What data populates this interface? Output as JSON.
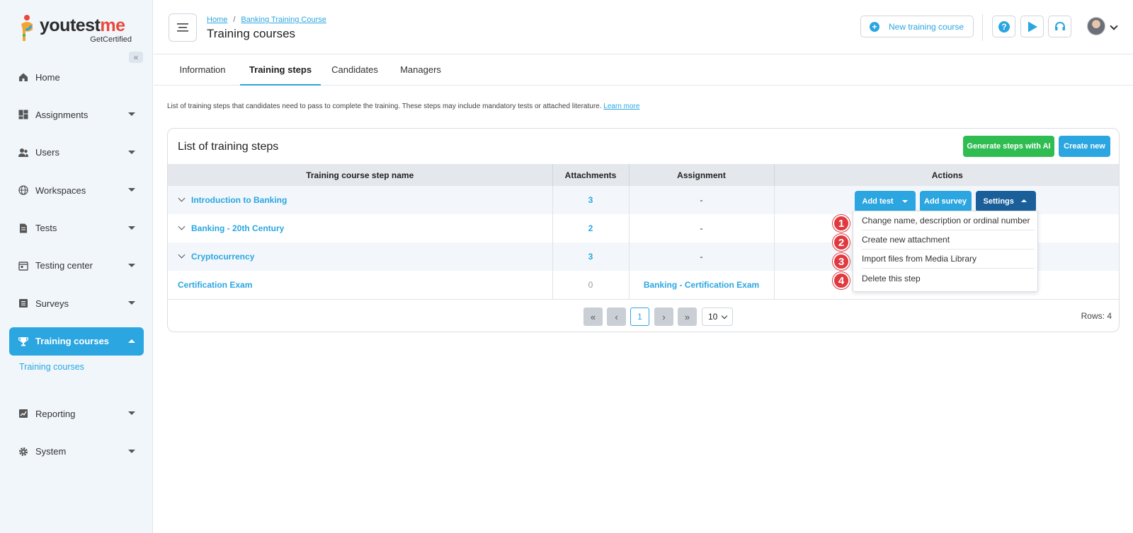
{
  "brand": {
    "name_a": "youtest",
    "name_b": "me",
    "tagline": "GetCertified"
  },
  "sidebar": {
    "items": [
      {
        "label": "Home",
        "icon": "home-icon",
        "has_caret": false
      },
      {
        "label": "Assignments",
        "icon": "dashboard-icon",
        "has_caret": true
      },
      {
        "label": "Users",
        "icon": "users-icon",
        "has_caret": true
      },
      {
        "label": "Workspaces",
        "icon": "globe-icon",
        "has_caret": true
      },
      {
        "label": "Tests",
        "icon": "file-icon",
        "has_caret": true
      },
      {
        "label": "Testing center",
        "icon": "calendar-icon",
        "has_caret": true
      },
      {
        "label": "Surveys",
        "icon": "list-icon",
        "has_caret": true
      },
      {
        "label": "Training courses",
        "icon": "trophy-icon",
        "has_caret": true,
        "active": true
      },
      {
        "label": "Reporting",
        "icon": "chart-icon",
        "has_caret": true
      },
      {
        "label": "System",
        "icon": "gear-icon",
        "has_caret": true
      }
    ],
    "subitem": "Training courses"
  },
  "header": {
    "breadcrumb": [
      "Home",
      "Banking Training Course"
    ],
    "title": "Training courses",
    "new_course_label": "New training course"
  },
  "tabs": [
    "Information",
    "Training steps",
    "Candidates",
    "Managers"
  ],
  "active_tab": "Training steps",
  "description": "List of training steps that candidates need to pass to complete the training. These steps may include mandatory tests or attached literature.",
  "learn_more": "Learn more",
  "card": {
    "title": "List of training steps",
    "generate_label": "Generate steps with AI",
    "create_label": "Create new"
  },
  "table": {
    "columns": [
      "Training course step name",
      "Attachments",
      "Assignment",
      "Actions"
    ],
    "rows": [
      {
        "name": "Introduction to Banking",
        "attachments": "3",
        "assignment": "-"
      },
      {
        "name": "Banking - 20th Century",
        "attachments": "2",
        "assignment": "-"
      },
      {
        "name": "Cryptocurrency",
        "attachments": "3",
        "assignment": "-"
      },
      {
        "name": "Certification Exam",
        "attachments": "0",
        "assignment": "Banking - Certification Exam"
      }
    ],
    "actions": {
      "add_test": "Add test",
      "add_survey": "Add survey",
      "settings": "Settings"
    }
  },
  "pager": {
    "current": "1",
    "page_size": "10",
    "rows_label": "Rows: 4"
  },
  "dropdown": {
    "items": [
      {
        "num": "1",
        "label": "Change name, description or ordinal number"
      },
      {
        "num": "2",
        "label": "Create new attachment"
      },
      {
        "num": "3",
        "label": "Import files from Media Library"
      },
      {
        "num": "4",
        "label": "Delete this step"
      }
    ]
  },
  "colors": {
    "accent": "#2ba6e0",
    "green": "#2fbd52",
    "dark_blue": "#1a5f9a",
    "badge_red": "#e0393e"
  }
}
